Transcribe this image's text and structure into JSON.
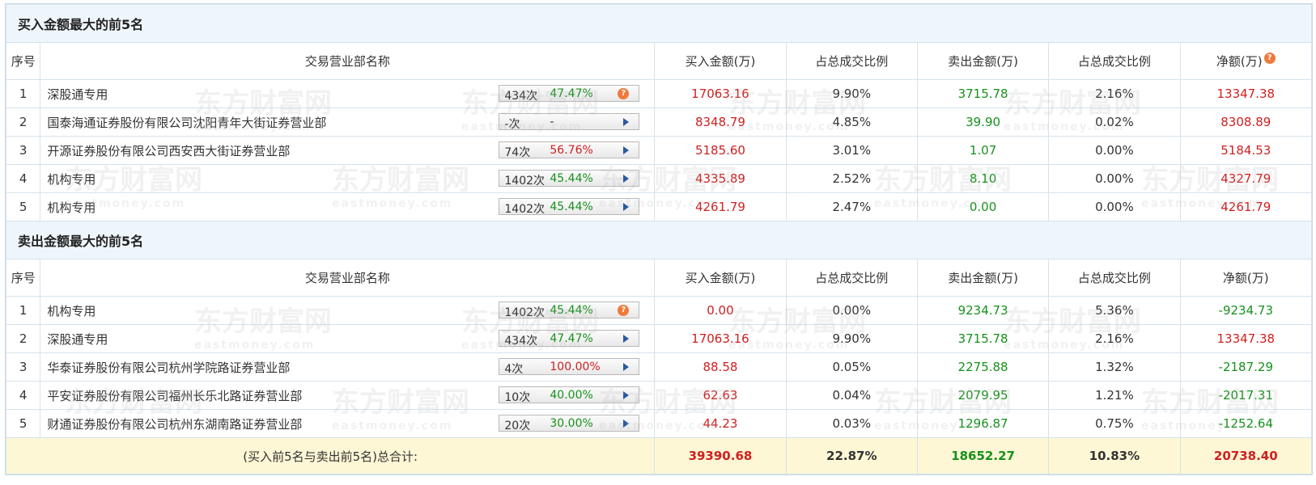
{
  "buy_section": {
    "title": "买入金额最大的前5名",
    "headers": [
      "序号",
      "交易营业部名称",
      "买入金额(万)",
      "占总成交比例",
      "卖出金额(万)",
      "占总成交比例",
      "净额(万)"
    ],
    "rows": [
      {
        "idx": "1",
        "name": "深股通专用",
        "count": "434次",
        "pct": "47.47%",
        "pct_color": "green",
        "icon": "help",
        "buy": "17063.16",
        "buy_ratio": "9.90%",
        "sell": "3715.78",
        "sell_ratio": "2.16%",
        "net": "13347.38",
        "net_color": "red"
      },
      {
        "idx": "2",
        "name": "国泰海通证券股份有限公司沈阳青年大街证券营业部",
        "count": "-次",
        "pct": "-",
        "pct_color": "plain",
        "icon": "arrow",
        "buy": "8348.79",
        "buy_ratio": "4.85%",
        "sell": "39.90",
        "sell_ratio": "0.02%",
        "net": "8308.89",
        "net_color": "red"
      },
      {
        "idx": "3",
        "name": "开源证券股份有限公司西安西大街证券营业部",
        "count": "74次",
        "pct": "56.76%",
        "pct_color": "red",
        "icon": "arrow",
        "buy": "5185.60",
        "buy_ratio": "3.01%",
        "sell": "1.07",
        "sell_ratio": "0.00%",
        "net": "5184.53",
        "net_color": "red"
      },
      {
        "idx": "4",
        "name": "机构专用",
        "count": "1402次",
        "pct": "45.44%",
        "pct_color": "green",
        "icon": "arrow",
        "buy": "4335.89",
        "buy_ratio": "2.52%",
        "sell": "8.10",
        "sell_ratio": "0.00%",
        "net": "4327.79",
        "net_color": "red"
      },
      {
        "idx": "5",
        "name": "机构专用",
        "count": "1402次",
        "pct": "45.44%",
        "pct_color": "green",
        "icon": "arrow",
        "buy": "4261.79",
        "buy_ratio": "2.47%",
        "sell": "0.00",
        "sell_ratio": "0.00%",
        "net": "4261.79",
        "net_color": "red"
      }
    ]
  },
  "sell_section": {
    "title": "卖出金额最大的前5名",
    "headers": [
      "序号",
      "交易营业部名称",
      "买入金额(万)",
      "占总成交比例",
      "卖出金额(万)",
      "占总成交比例",
      "净额(万)"
    ],
    "rows": [
      {
        "idx": "1",
        "name": "机构专用",
        "count": "1402次",
        "pct": "45.44%",
        "pct_color": "green",
        "icon": "help",
        "buy": "0.00",
        "buy_ratio": "0.00%",
        "sell": "9234.73",
        "sell_ratio": "5.36%",
        "net": "-9234.73",
        "net_color": "green"
      },
      {
        "idx": "2",
        "name": "深股通专用",
        "count": "434次",
        "pct": "47.47%",
        "pct_color": "green",
        "icon": "arrow",
        "buy": "17063.16",
        "buy_ratio": "9.90%",
        "sell": "3715.78",
        "sell_ratio": "2.16%",
        "net": "13347.38",
        "net_color": "red"
      },
      {
        "idx": "3",
        "name": "华泰证券股份有限公司杭州学院路证券营业部",
        "count": "4次",
        "pct": "100.00%",
        "pct_color": "red",
        "icon": "arrow",
        "buy": "88.58",
        "buy_ratio": "0.05%",
        "sell": "2275.88",
        "sell_ratio": "1.32%",
        "net": "-2187.29",
        "net_color": "green"
      },
      {
        "idx": "4",
        "name": "平安证券股份有限公司福州长乐北路证券营业部",
        "count": "10次",
        "pct": "40.00%",
        "pct_color": "green",
        "icon": "arrow",
        "buy": "62.63",
        "buy_ratio": "0.04%",
        "sell": "2079.95",
        "sell_ratio": "1.21%",
        "net": "-2017.31",
        "net_color": "green"
      },
      {
        "idx": "5",
        "name": "财通证券股份有限公司杭州东湖南路证券营业部",
        "count": "20次",
        "pct": "30.00%",
        "pct_color": "green",
        "icon": "arrow",
        "buy": "44.23",
        "buy_ratio": "0.03%",
        "sell": "1296.87",
        "sell_ratio": "0.75%",
        "net": "-1252.64",
        "net_color": "green"
      }
    ]
  },
  "total": {
    "label": "(买入前5名与卖出前5名)总合计:",
    "buy": "39390.68",
    "buy_ratio": "22.87%",
    "sell": "18652.27",
    "sell_ratio": "10.83%",
    "net": "20738.40"
  },
  "watermark": {
    "cn": "东方财富网",
    "en": "eastmoney.com"
  },
  "help_glyph": "?",
  "colors": {
    "red": "#d01f1f",
    "green": "#16911b",
    "section_bg": "#eef6fc",
    "total_bg": "#fdf7d6"
  }
}
